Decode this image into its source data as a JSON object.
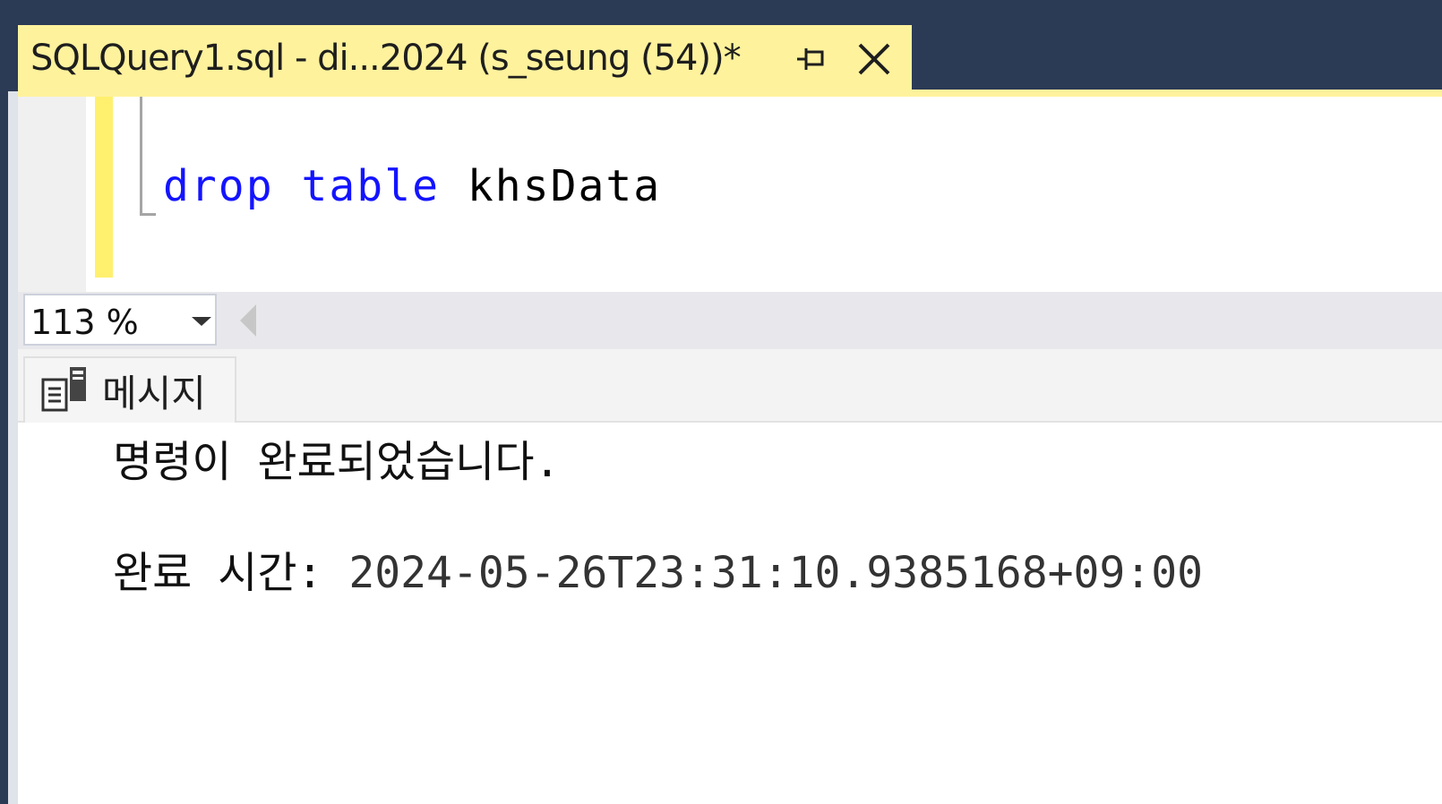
{
  "tab": {
    "title": "SQLQuery1.sql - di...2024 (s_seung (54))*",
    "pin_icon": "pin-icon",
    "close_icon": "close-icon"
  },
  "editor": {
    "code": {
      "keyword1": "drop",
      "keyword2": "table",
      "identifier": "khsData"
    }
  },
  "zoom": {
    "value": "113 %"
  },
  "results": {
    "messages_tab_label": "메시지",
    "messages_icon": "messages-icon",
    "line1": "명령이 완료되었습니다.",
    "line2_label": "완료 시간: ",
    "line2_value": "2024-05-26T23:31:10.9385168+09:00"
  },
  "colors": {
    "frame": "#2b3a55",
    "tab_active": "#fff29d",
    "keyword": "#1414ff",
    "change_bar": "#fff06e"
  }
}
